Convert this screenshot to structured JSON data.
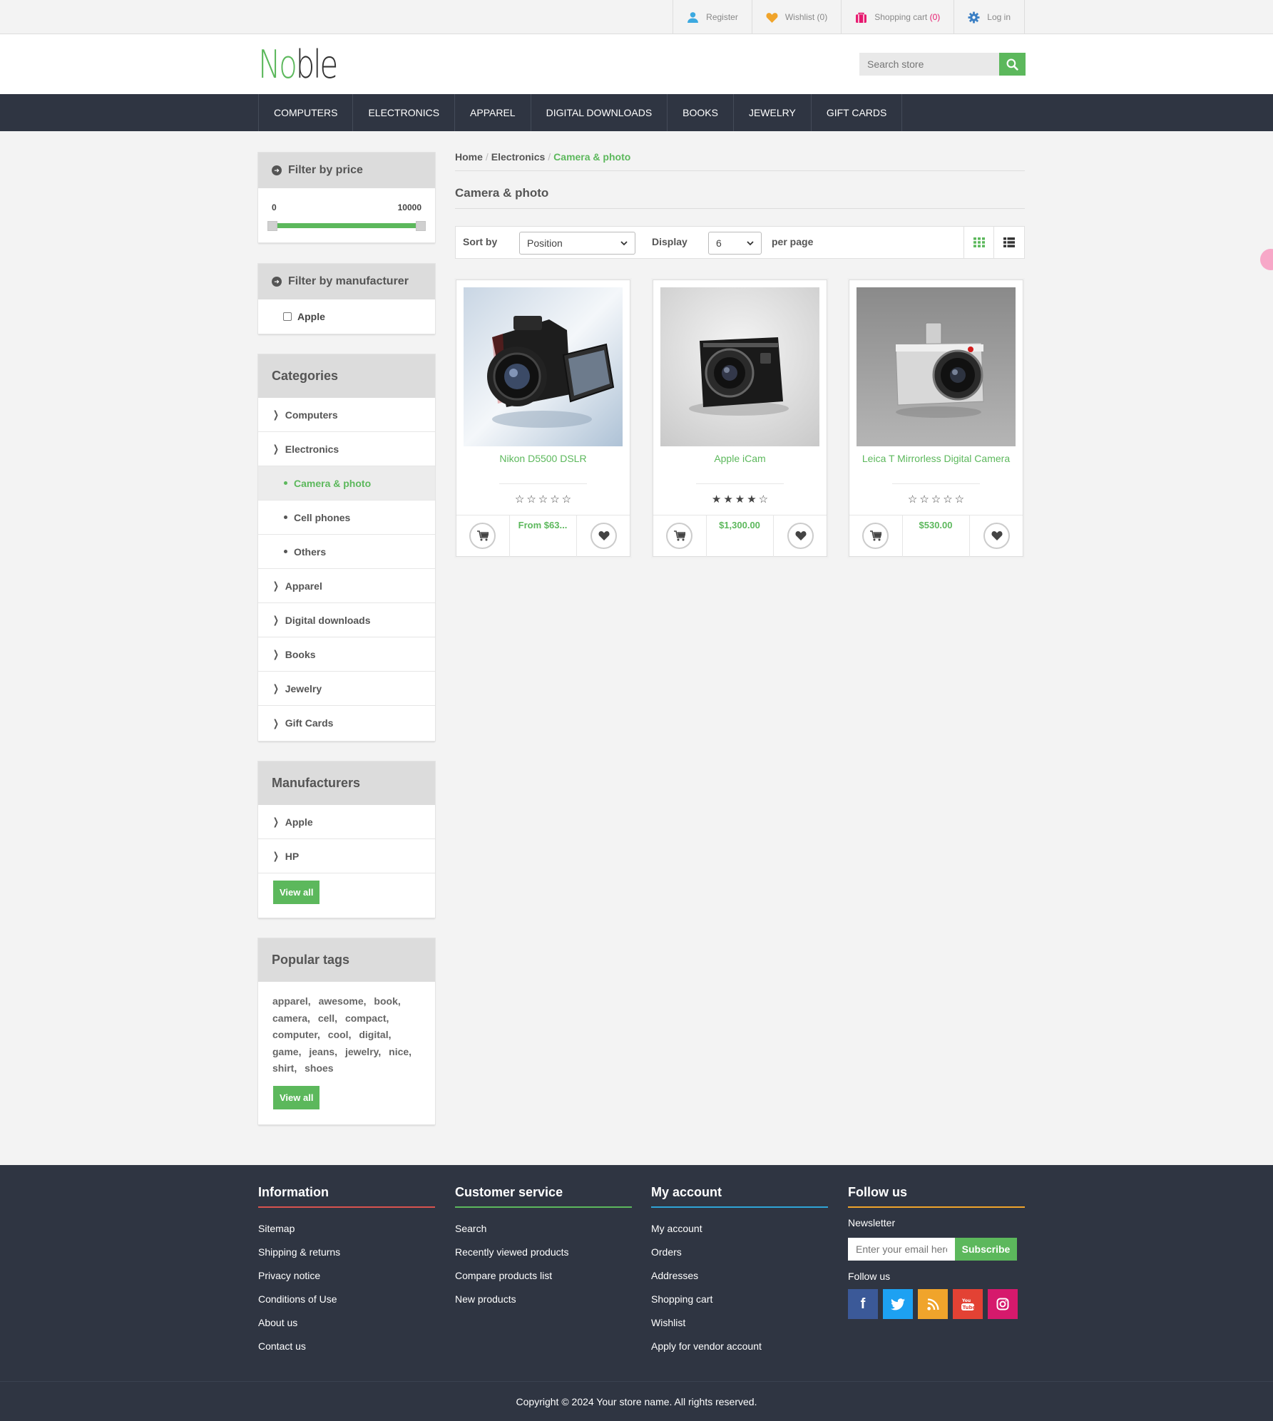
{
  "topbar": {
    "register": "Register",
    "wishlist": "Wishlist",
    "wishlist_qty": "(0)",
    "cart": "Shopping cart",
    "cart_qty": "(0)",
    "login": "Log in",
    "icons": [
      "user-icon",
      "heart-icon",
      "shopping-bag-icon",
      "gear-icon"
    ]
  },
  "header": {
    "logo_part1": "No",
    "logo_part2": "ble",
    "search_placeholder": "Search store"
  },
  "nav": [
    "COMPUTERS",
    "ELECTRONICS",
    "APPAREL",
    "DIGITAL DOWNLOADS",
    "BOOKS",
    "JEWELRY",
    "GIFT CARDS"
  ],
  "filter_price": {
    "title": "Filter by price",
    "min": "0",
    "max": "10000"
  },
  "filter_manufacturer": {
    "title": "Filter by manufacturer",
    "items": [
      "Apple"
    ]
  },
  "categories": {
    "title": "Categories",
    "items": [
      {
        "label": "Computers"
      },
      {
        "label": "Electronics"
      },
      {
        "label": "Camera & photo"
      },
      {
        "label": "Cell phones"
      },
      {
        "label": "Others"
      },
      {
        "label": "Apparel"
      },
      {
        "label": "Digital downloads"
      },
      {
        "label": "Books"
      },
      {
        "label": "Jewelry"
      },
      {
        "label": "Gift Cards"
      }
    ]
  },
  "manufacturers": {
    "title": "Manufacturers",
    "items": [
      "Apple",
      "HP"
    ],
    "view_all": "View all"
  },
  "popular_tags": {
    "title": "Popular tags",
    "tags": [
      "apparel,",
      "awesome,",
      "book,",
      "camera,",
      "cell,",
      "compact,",
      "computer,",
      "cool,",
      "digital,",
      "game,",
      "jeans,",
      "jewelry,",
      "nice,",
      "shirt,",
      "shoes"
    ],
    "view_all": "View all"
  },
  "breadcrumb": {
    "home": "Home",
    "level1": "Electronics",
    "current": "Camera & photo",
    "sep": "/"
  },
  "page_title": "Camera & photo",
  "toolbar": {
    "sort_label": "Sort by",
    "sort_value": "Position",
    "display_label": "Display",
    "display_value": "6",
    "per_page": "per page"
  },
  "products": [
    {
      "name": "Nikon D5500 DSLR",
      "price": "From $63...",
      "rating": 0
    },
    {
      "name": "Apple iCam",
      "price": "$1,300.00",
      "rating": 4
    },
    {
      "name": "Leica T Mirrorless Digital Camera",
      "price": "$530.00",
      "rating": 0
    }
  ],
  "footer": {
    "information": {
      "title": "Information",
      "links": [
        "Sitemap",
        "Shipping & returns",
        "Privacy notice",
        "Conditions of Use",
        "About us",
        "Contact us"
      ]
    },
    "customer_service": {
      "title": "Customer service",
      "links": [
        "Search",
        "Recently viewed products",
        "Compare products list",
        "New products"
      ]
    },
    "my_account": {
      "title": "My account",
      "links": [
        "My account",
        "Orders",
        "Addresses",
        "Shopping cart",
        "Wishlist",
        "Apply for vendor account"
      ]
    },
    "follow_us": {
      "title": "Follow us",
      "newsletter": "Newsletter",
      "email_placeholder": "Enter your email here...",
      "subscribe": "Subscribe",
      "follow_label": "Follow us",
      "social": [
        "facebook-icon",
        "twitter-icon",
        "rss-icon",
        "youtube-icon",
        "instagram-icon"
      ]
    },
    "colors": {
      "information": "#d9534f",
      "customer_service": "#5cb85c",
      "my_account": "#2fa4d7",
      "follow_us": "#f0a42b"
    },
    "copyright": "Copyright © 2024 Your store name. All rights reserved."
  },
  "colors": {
    "accent": "#5cb85c",
    "nav_bg": "#2f3542"
  }
}
